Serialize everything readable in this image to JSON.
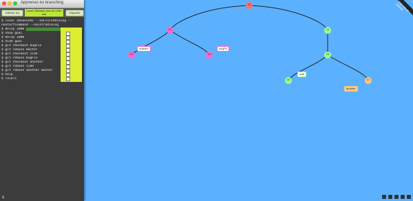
{
  "window": {
    "title": "Apprenez-toi branching"
  },
  "toolbar": {
    "left_button": "Afficher les objectifs",
    "level_banner": "Level: Rebaser plus de 1000 fois",
    "right_button": "Objectifs"
  },
  "terminal": {
    "lines": [
      "$ level advanced1 --noFinishDialog --",
      "noStartCommand --noIntroDialog",
      "$ delay 2000",
      "$ show goal",
      "$ delay 1000",
      "$ hide goal",
      "$ git checkout bugFix",
      "$ git rebase master",
      "$ git checkout side",
      "$ git rebase bugFix",
      "$ git checkout another",
      "$ git rebase side",
      "$ git rebase another master",
      "$ help",
      "$ levels"
    ],
    "prompt": "$"
  },
  "graph": {
    "nodes": [
      {
        "id": "C0",
        "color": "#ff7070"
      },
      {
        "id": "C1",
        "color": "#ff66cc"
      },
      {
        "id": "C2",
        "color": "#ff66cc"
      },
      {
        "id": "C3",
        "color": "#ff66cc"
      },
      {
        "id": "C4",
        "color": "#a0ff8c"
      },
      {
        "id": "C5",
        "color": "#a0ff8c"
      },
      {
        "id": "C6",
        "color": "#a0ff8c"
      },
      {
        "id": "C7",
        "color": "#ffc880"
      }
    ],
    "branches": [
      {
        "label": "master*",
        "color": "#ff66cc"
      },
      {
        "label": "bugFix",
        "color": "#ff66cc"
      },
      {
        "label": "side",
        "color": "#a0ff8c"
      },
      {
        "label": "another",
        "color": "#ffc880"
      }
    ]
  },
  "corner_badge": {
    "text": "Fork me on GitHub"
  }
}
